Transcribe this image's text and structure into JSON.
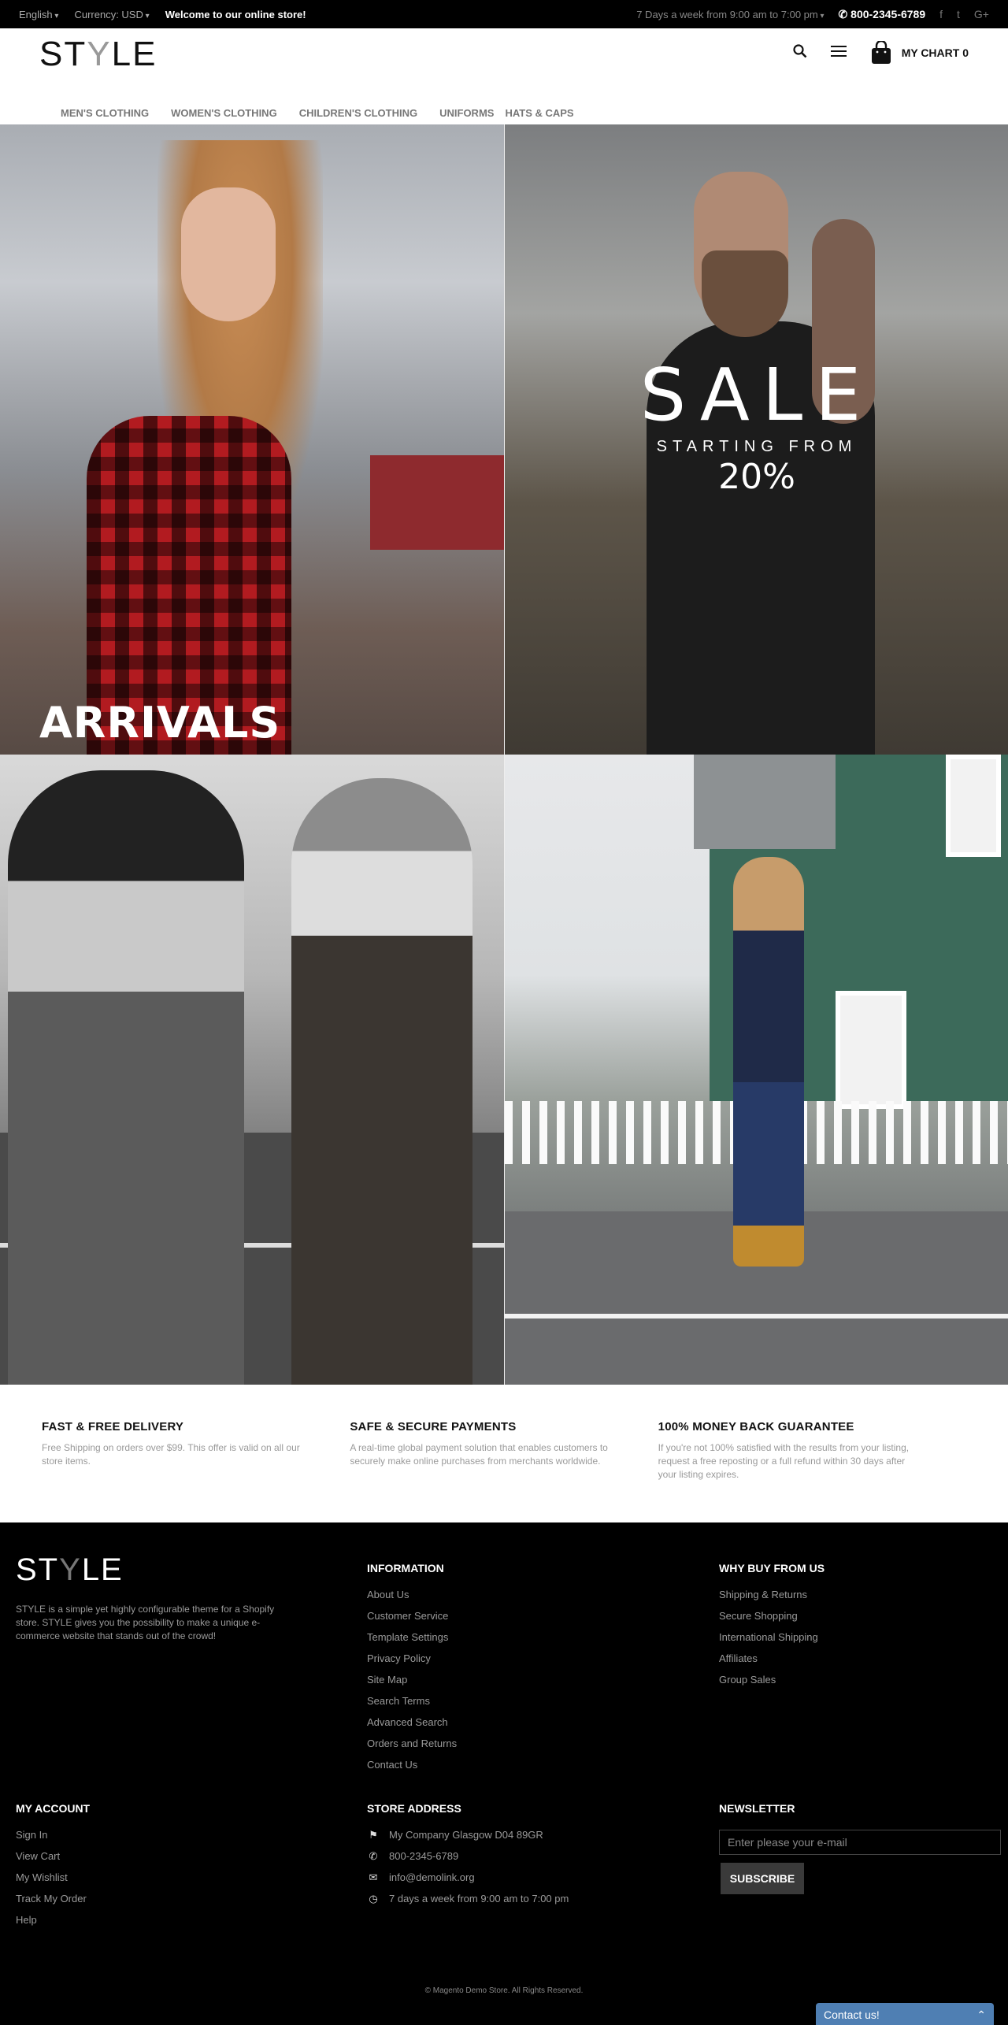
{
  "topbar": {
    "language": "English",
    "currency": "Currency: USD",
    "welcome": "Welcome to our online store!",
    "hours": "7 Days a week from 9:00 am to 7:00 pm",
    "phone": "800-2345-6789",
    "social": [
      "f",
      "t",
      "G+"
    ]
  },
  "header": {
    "logo_pre": "ST",
    "logo_y": "Y",
    "logo_post": "LE",
    "cart_label": "MY CHART 0"
  },
  "nav": {
    "items": [
      "MEN'S CLOTHING",
      "WOMEN'S CLOTHING",
      "CHILDREN'S CLOTHING",
      "UNIFORMS",
      "HATS & CAPS"
    ]
  },
  "banners": {
    "arrivals": "ARRIVALS",
    "sale_title": "SALE",
    "sale_sub": "STARTING FROM",
    "sale_pct": "20%"
  },
  "features": [
    {
      "title": "FAST & FREE DELIVERY",
      "text": "Free Shipping on orders over $99. This offer is valid on all our store items."
    },
    {
      "title": "SAFE & SECURE PAYMENTS",
      "text": "A real-time global payment solution that enables customers to securely make online purchases from merchants worldwide."
    },
    {
      "title": "100% MONEY BACK GUARANTEE",
      "text": "If you're not 100% satisfied with the results from your listing, request a free reposting or a full refund within 30 days after your listing expires."
    }
  ],
  "footer": {
    "logo_pre": "ST",
    "logo_y": "Y",
    "logo_post": "LE",
    "description": "STYLE is a simple yet highly configurable theme for a Shopify store. STYLE gives you the possibility to make a unique e-commerce website that stands out of the crowd!",
    "information": {
      "title": "INFORMATION",
      "items": [
        "About Us",
        "Customer Service",
        "Template Settings",
        "Privacy Policy",
        "Site Map",
        "Search Terms",
        "Advanced Search",
        "Orders and Returns",
        "Contact Us"
      ]
    },
    "why": {
      "title": "WHY BUY FROM US",
      "items": [
        "Shipping & Returns",
        "Secure Shopping",
        "International Shipping",
        "Affiliates",
        "Group Sales"
      ]
    },
    "account": {
      "title": "MY ACCOUNT",
      "items": [
        "Sign In",
        "View Cart",
        "My Wishlist",
        "Track My Order",
        "Help"
      ]
    },
    "store": {
      "title": "STORE ADDRESS",
      "address": "My Company Glasgow D04 89GR",
      "phone": "800-2345-6789",
      "email": "info@demolink.org",
      "hours": "7 days a week from 9:00 am to 7:00 pm"
    },
    "newsletter": {
      "title": "NEWSLETTER",
      "placeholder": "Enter please your e-mail",
      "button": "SUBSCRIBE"
    },
    "copyright": "© Magento Demo Store. All Rights Reserved.",
    "contact": "Contact us!"
  }
}
